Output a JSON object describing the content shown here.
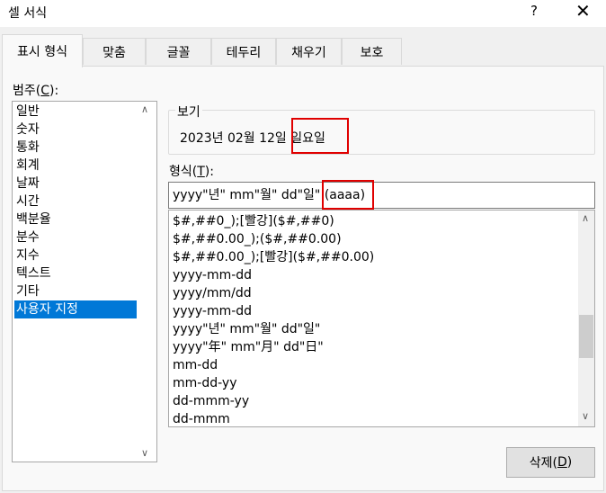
{
  "window": {
    "title": "셀 서식",
    "help": "?",
    "close": "✕"
  },
  "tabs": [
    {
      "label": "표시 형식",
      "active": true
    },
    {
      "label": "맞춤"
    },
    {
      "label": "글꼴"
    },
    {
      "label": "테두리"
    },
    {
      "label": "채우기"
    },
    {
      "label": "보호"
    }
  ],
  "category": {
    "label_pre": "범주(",
    "label_key": "C",
    "label_post": "):",
    "items": [
      "일반",
      "숫자",
      "통화",
      "회계",
      "날짜",
      "시간",
      "백분율",
      "분수",
      "지수",
      "텍스트",
      "기타",
      "사용자 지정"
    ],
    "selected": "사용자 지정"
  },
  "sample": {
    "legend": "보기",
    "value": "2023년 02월 12일 일요일"
  },
  "format": {
    "label_pre": "형식(",
    "label_key": "T",
    "label_post": "):",
    "input_value": "yyyy\"년\" mm\"월\" dd\"일\" (aaaa)",
    "items": [
      "$#,##0_);[빨강]($#,##0)",
      "$#,##0.00_);($#,##0.00)",
      "$#,##0.00_);[빨강]($#,##0.00)",
      "yyyy-mm-dd",
      "yyyy/mm/dd",
      "yyyy-mm-dd",
      "yyyy\"년\" mm\"월\" dd\"일\"",
      "yyyy\"年\" mm\"月\" dd\"日\"",
      "mm-dd",
      "mm-dd-yy",
      "dd-mmm-yy",
      "dd-mmm"
    ]
  },
  "buttons": {
    "delete_pre": "삭제(",
    "delete_key": "D",
    "delete_post": ")"
  },
  "icons": {
    "up": "∧",
    "down": "∨"
  },
  "colors": {
    "selection": "#0078d7",
    "highlight": "#e00000"
  }
}
